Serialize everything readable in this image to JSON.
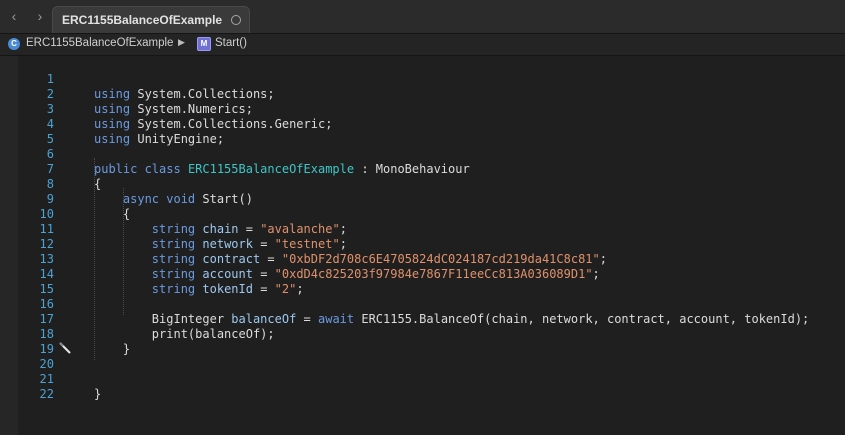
{
  "tab": {
    "title": "ERC1155BalanceOfExample"
  },
  "jumpbar": {
    "file": "ERC1155BalanceOfExample",
    "method": "Start()"
  },
  "icons": {
    "back": "chevron-left-icon",
    "forward": "chevron-right-icon",
    "file": "csharp-file-icon",
    "method": "method-icon"
  },
  "code": {
    "line_numbers": [
      "1",
      "2",
      "3",
      "4",
      "5",
      "6",
      "7",
      "8",
      "9",
      "10",
      "11",
      "12",
      "13",
      "14",
      "15",
      "16",
      "17",
      "18",
      "19",
      "20",
      "21",
      "22"
    ],
    "l1": {
      "kw": "using",
      "rest": " System.Collections;"
    },
    "l2": {
      "kw": "using",
      "rest": " System.Numerics;"
    },
    "l3": {
      "kw": "using",
      "rest": " System.Collections.Generic;"
    },
    "l4": {
      "kw": "using",
      "rest": " UnityEngine;"
    },
    "l6": {
      "kw": "public class",
      "cls": "ERC1155BalanceOfExample",
      "rest": " : MonoBehaviour"
    },
    "l7": {
      "rest": "{"
    },
    "l8": {
      "kw": "async void",
      "rest": " Start()"
    },
    "l9": {
      "rest": "{"
    },
    "l10": {
      "ty": "string",
      "var": "chain",
      "eq": " = ",
      "str": "\"avalanche\"",
      "end": ";"
    },
    "l11": {
      "ty": "string",
      "var": "network",
      "eq": " = ",
      "str": "\"testnet\"",
      "end": ";"
    },
    "l12": {
      "ty": "string",
      "var": "contract",
      "eq": " = ",
      "str": "\"0xbDF2d708c6E4705824dC024187cd219da41C8c81\"",
      "end": ";"
    },
    "l13": {
      "ty": "string",
      "var": "account",
      "eq": " = ",
      "str": "\"0xdD4c825203f97984e7867F11eeCc813A036089D1\"",
      "end": ";"
    },
    "l14": {
      "ty": "string",
      "var": "tokenId",
      "eq": " = ",
      "str": "\"2\"",
      "end": ";"
    },
    "l16": {
      "ty": "BigInteger",
      "var": "balanceOf",
      "eq": " = ",
      "kw": "await",
      "rest": " ERC1155.BalanceOf(chain, network, contract, account, tokenId);"
    },
    "l17": {
      "rest": "print(balanceOf);"
    },
    "l18": {
      "rest": "}"
    },
    "l21": {
      "rest": "}"
    }
  }
}
